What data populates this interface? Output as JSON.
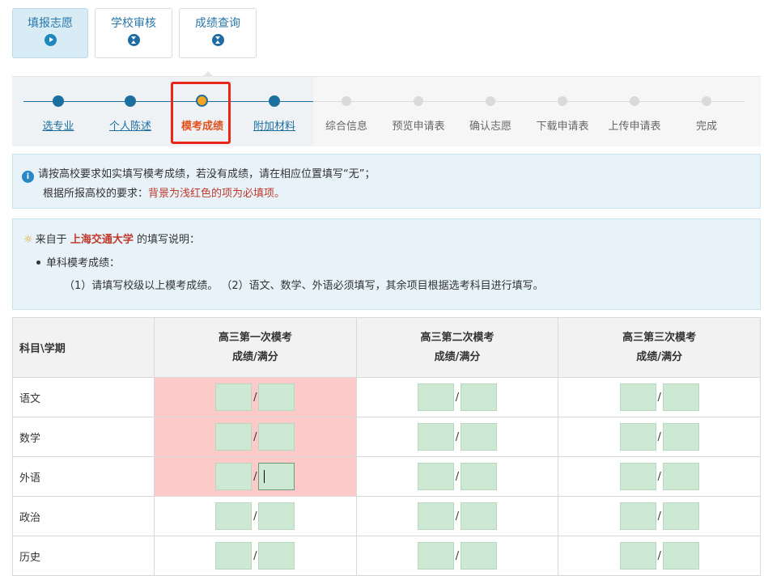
{
  "nav": {
    "tabs": [
      {
        "label": "填报志愿",
        "icon": "play-circle-icon"
      },
      {
        "label": "学校审核",
        "icon": "hourglass-icon"
      },
      {
        "label": "成绩查询",
        "icon": "hourglass-icon"
      }
    ]
  },
  "steps": [
    {
      "label": "选专业",
      "state": "done"
    },
    {
      "label": "个人陈述",
      "state": "done"
    },
    {
      "label": "模考成绩",
      "state": "current"
    },
    {
      "label": "附加材料",
      "state": "done"
    },
    {
      "label": "综合信息",
      "state": "pending"
    },
    {
      "label": "预览申请表",
      "state": "pending"
    },
    {
      "label": "确认志愿",
      "state": "pending"
    },
    {
      "label": "下载申请表",
      "state": "pending"
    },
    {
      "label": "上传申请表",
      "state": "pending"
    },
    {
      "label": "完成",
      "state": "pending"
    }
  ],
  "notice": {
    "line1": "请按高校要求如实填写模考成绩，若没有成绩，请在相应位置填写“无”；",
    "line2_prefix": "根据所报高校的要求：",
    "line2_red": "背景为浅红色的项为必填项。"
  },
  "instructions": {
    "prefix": "来自于",
    "university": "上海交通大学",
    "suffix": "的填写说明：",
    "bullet": "单科模考成绩：",
    "detail": "（1）请填写校级以上模考成绩。  （2）语文、数学、外语必须填写，其余项目根据选考科目进行填写。"
  },
  "table": {
    "subject_header": "科目\\学期",
    "exams": [
      {
        "name": "高三第一次模考",
        "sub": "成绩/满分"
      },
      {
        "name": "高三第二次模考",
        "sub": "成绩/满分"
      },
      {
        "name": "高三第三次模考",
        "sub": "成绩/满分"
      }
    ],
    "rows": [
      "语文",
      "数学",
      "外语",
      "政治",
      "历史"
    ],
    "slash": "/"
  },
  "colors": {
    "accent": "#1d6fa0",
    "current_step": "#e0521e",
    "required_bg": "#fdcaca",
    "input_bg": "#cde8d3",
    "highlight": "#e8261b"
  }
}
